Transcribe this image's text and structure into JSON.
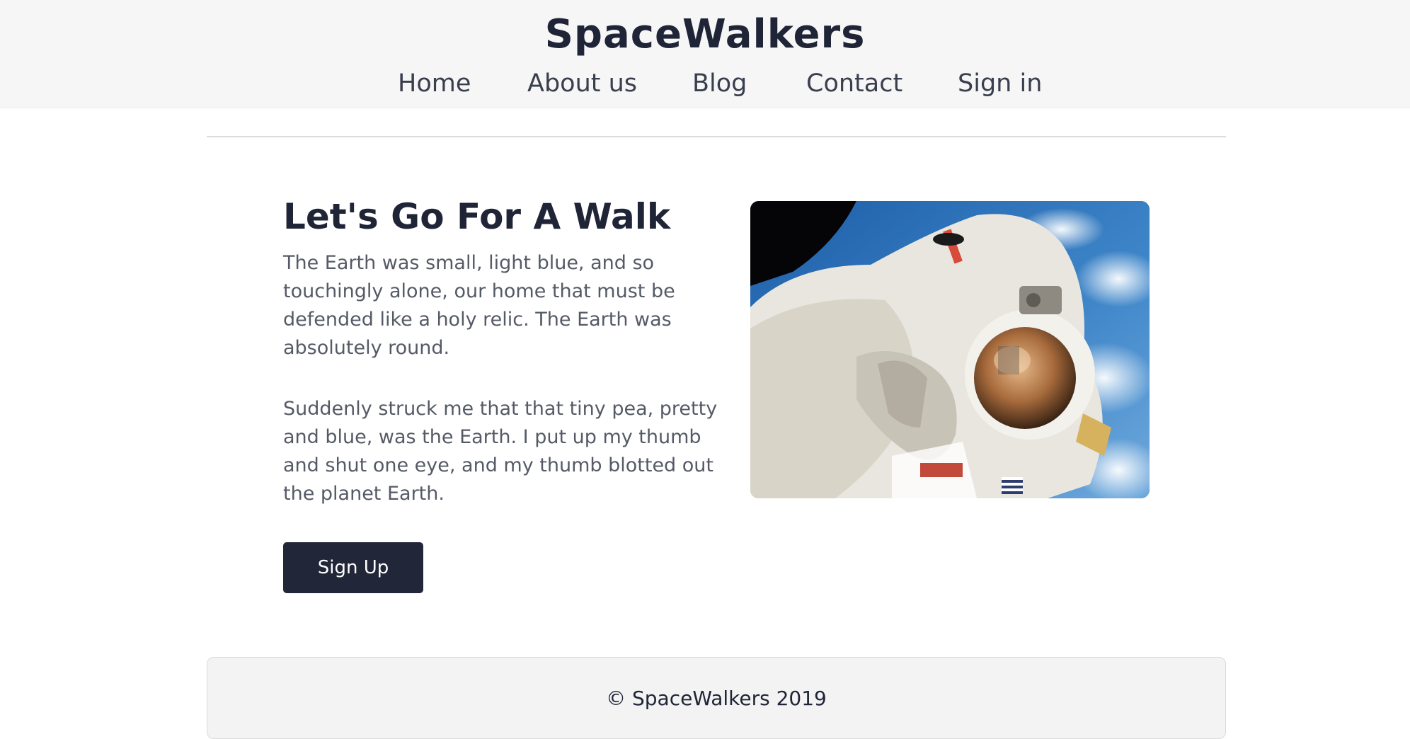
{
  "header": {
    "brand": "SpaceWalkers",
    "nav": [
      {
        "label": "Home"
      },
      {
        "label": "About us"
      },
      {
        "label": "Blog"
      },
      {
        "label": "Contact"
      },
      {
        "label": "Sign in"
      }
    ]
  },
  "hero": {
    "title": "Let's Go For A Walk",
    "paragraphs": [
      "The Earth was small, light blue, and so touchingly alone, our home that must be defended like a holy relic. The Earth was absolutely round.",
      "Suddenly struck me that that tiny pea, pretty and blue, was the Earth. I put up my thumb and shut one eye, and my thumb blotted out the planet Earth."
    ],
    "cta_label": "Sign Up",
    "image_icon": "astronaut-photo"
  },
  "footer": {
    "text": "© SpaceWalkers 2019"
  },
  "colors": {
    "header_bg": "#f6f6f7",
    "text_dark": "#1f2437",
    "text_body": "#555a66",
    "button_bg": "#222639",
    "footer_bg": "#f3f3f3"
  }
}
